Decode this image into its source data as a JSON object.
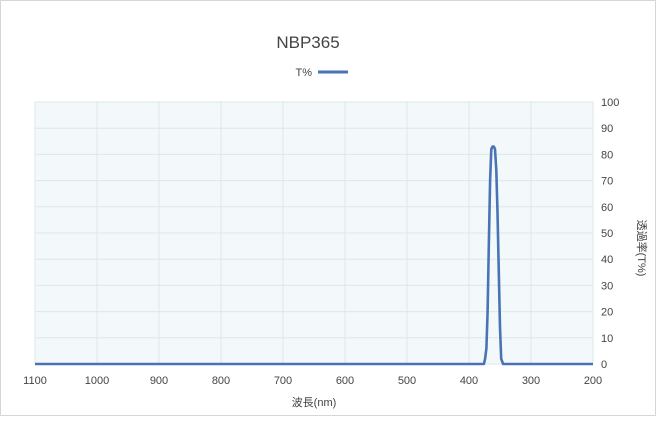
{
  "chart_data": {
    "type": "line",
    "title": "NBP365",
    "xlabel": "波長(nm)",
    "ylabel": "透過率(T%)",
    "x_axis_reversed": true,
    "y_axis_side": "right",
    "xlim": [
      200,
      1100
    ],
    "ylim": [
      0,
      100
    ],
    "x_ticks": [
      200,
      300,
      400,
      500,
      600,
      700,
      800,
      900,
      1000,
      1100
    ],
    "x_tick_labels": [
      "200",
      "300",
      "400",
      "500",
      "600",
      "700",
      "800",
      "900",
      "1000",
      "1100"
    ],
    "y_ticks": [
      0,
      10,
      20,
      30,
      40,
      50,
      60,
      70,
      80,
      90,
      100
    ],
    "y_tick_labels": [
      "0",
      "10",
      "20",
      "30",
      "40",
      "50",
      "60",
      "70",
      "80",
      "90",
      "100"
    ],
    "grid": true,
    "legend_position": "top-center",
    "colors": {
      "series": "#4a73b5",
      "plot_bg": "#f3f9fa",
      "grid": "#dde7ea"
    },
    "series": [
      {
        "name": "T%",
        "x": [
          200,
          300,
          340,
          345,
          348,
          350,
          352,
          354,
          356,
          358,
          360,
          362,
          364,
          366,
          368,
          370,
          372,
          374,
          376,
          378,
          380,
          385,
          400,
          500,
          600,
          700,
          800,
          900,
          1000,
          1100
        ],
        "values": [
          0,
          0,
          0,
          0,
          2,
          14,
          35,
          58,
          74,
          82,
          83,
          83,
          82,
          70,
          45,
          20,
          6,
          2,
          0,
          0,
          0,
          0,
          0,
          0,
          0,
          0,
          0,
          0,
          0,
          0
        ]
      }
    ]
  }
}
